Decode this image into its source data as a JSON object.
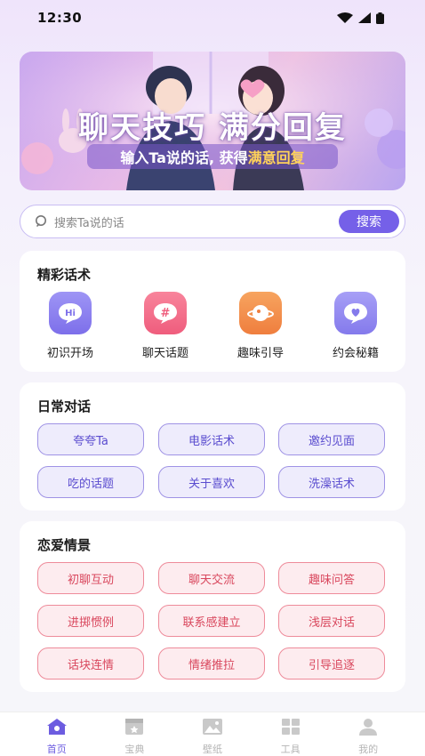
{
  "status": {
    "time": "12:30"
  },
  "banner": {
    "title": "聊天技巧 满分回复",
    "subtitle_plain": "输入Ta说的话, 获得",
    "subtitle_highlight": "满意回复"
  },
  "search": {
    "placeholder": "搜索Ta说的话",
    "button": "搜索"
  },
  "featured": {
    "title": "精彩话术",
    "items": [
      {
        "label": "初识开场",
        "icon": "hi-bubble-icon",
        "color": "#8b7ff0"
      },
      {
        "label": "聊天话题",
        "icon": "hashtag-bubble-icon",
        "color": "#f06b86"
      },
      {
        "label": "趣味引导",
        "icon": "planet-icon",
        "color": "#f3914f"
      },
      {
        "label": "约会秘籍",
        "icon": "heart-bubble-icon",
        "color": "#8f86ef"
      }
    ]
  },
  "daily": {
    "title": "日常对话",
    "chips": [
      "夸夸Ta",
      "电影话术",
      "邀约见面",
      "吃的话题",
      "关于喜欢",
      "洗澡话术"
    ]
  },
  "love": {
    "title": "恋爱情景",
    "chips": [
      "初聊互动",
      "聊天交流",
      "趣味问答",
      "进掷惯例",
      "联系感建立",
      "浅层对话",
      "话块连情",
      "情绪推拉",
      "引导追逐"
    ]
  },
  "tabbar": {
    "items": [
      {
        "label": "首页",
        "icon": "home-icon",
        "active": true
      },
      {
        "label": "宝典",
        "icon": "book-icon",
        "active": false
      },
      {
        "label": "壁纸",
        "icon": "image-icon",
        "active": false
      },
      {
        "label": "工具",
        "icon": "grid-icon",
        "active": false
      },
      {
        "label": "我的",
        "icon": "person-icon",
        "active": false
      }
    ]
  }
}
